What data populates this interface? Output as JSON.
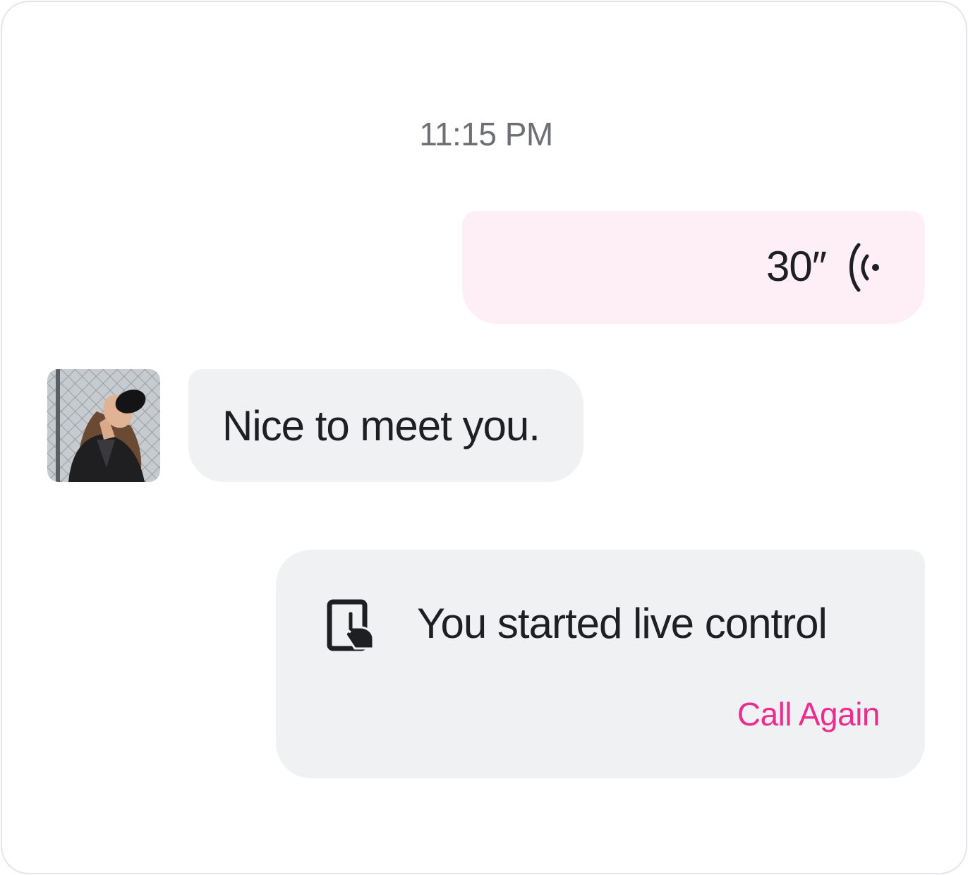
{
  "chat": {
    "timestamp": "11:15 PM",
    "messages": [
      {
        "type": "voice",
        "direction": "outgoing",
        "duration": "30″",
        "icon": "voice-wave-icon",
        "background": "#fdeff5"
      },
      {
        "type": "text",
        "direction": "incoming",
        "text": "Nice to meet you.",
        "avatar": "user-avatar-photo",
        "background": "#f0f1f3"
      },
      {
        "type": "live-control",
        "direction": "outgoing",
        "text": "You started live control",
        "icon": "tablet-touch-icon",
        "action_label": "Call Again",
        "action_color": "#ec2c8f",
        "background": "#f0f1f3"
      }
    ]
  }
}
